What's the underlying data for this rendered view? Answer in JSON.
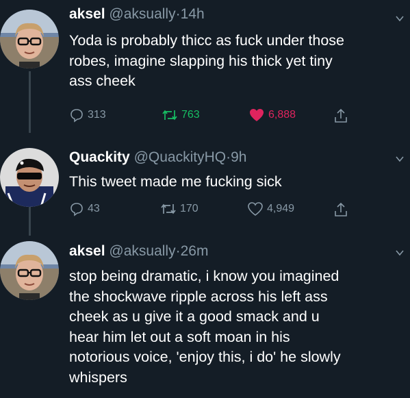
{
  "tweets": [
    {
      "name": "aksel",
      "handle": "@aksually",
      "time": "14h",
      "text_lines": [
        "Yoda is probably thicc as fuck under those",
        "robes, imagine slapping his thick yet tiny",
        "ass cheek"
      ],
      "replies": "313",
      "retweets": "763",
      "likes": "6,888",
      "liked": true
    },
    {
      "name": "Quackity",
      "handle": "@QuackityHQ",
      "time": "9h",
      "text_lines": [
        "This tweet made me fucking sick"
      ],
      "replies": "43",
      "retweets": "170",
      "likes": "4,949",
      "liked": false
    },
    {
      "name": "aksel",
      "handle": "@aksually",
      "time": "26m",
      "text_lines": [
        "stop being dramatic, i know you imagined",
        "the shockwave ripple across his left ass",
        "cheek as u give it a good smack and u",
        "hear him let out a soft moan in his",
        "notorious voice, 'enjoy this, i do' he slowly",
        "whispers"
      ]
    }
  ],
  "ui": {
    "separator": "·",
    "colors": {
      "background": "#141d26",
      "secondary_text": "#8899a6",
      "like": "#e0245e",
      "retweet_green": "#17bf63"
    },
    "icons": {
      "reply": "reply-icon",
      "retweet": "retweet-icon",
      "like": "heart-icon",
      "share": "share-icon",
      "menu": "chevron-down-icon"
    }
  }
}
